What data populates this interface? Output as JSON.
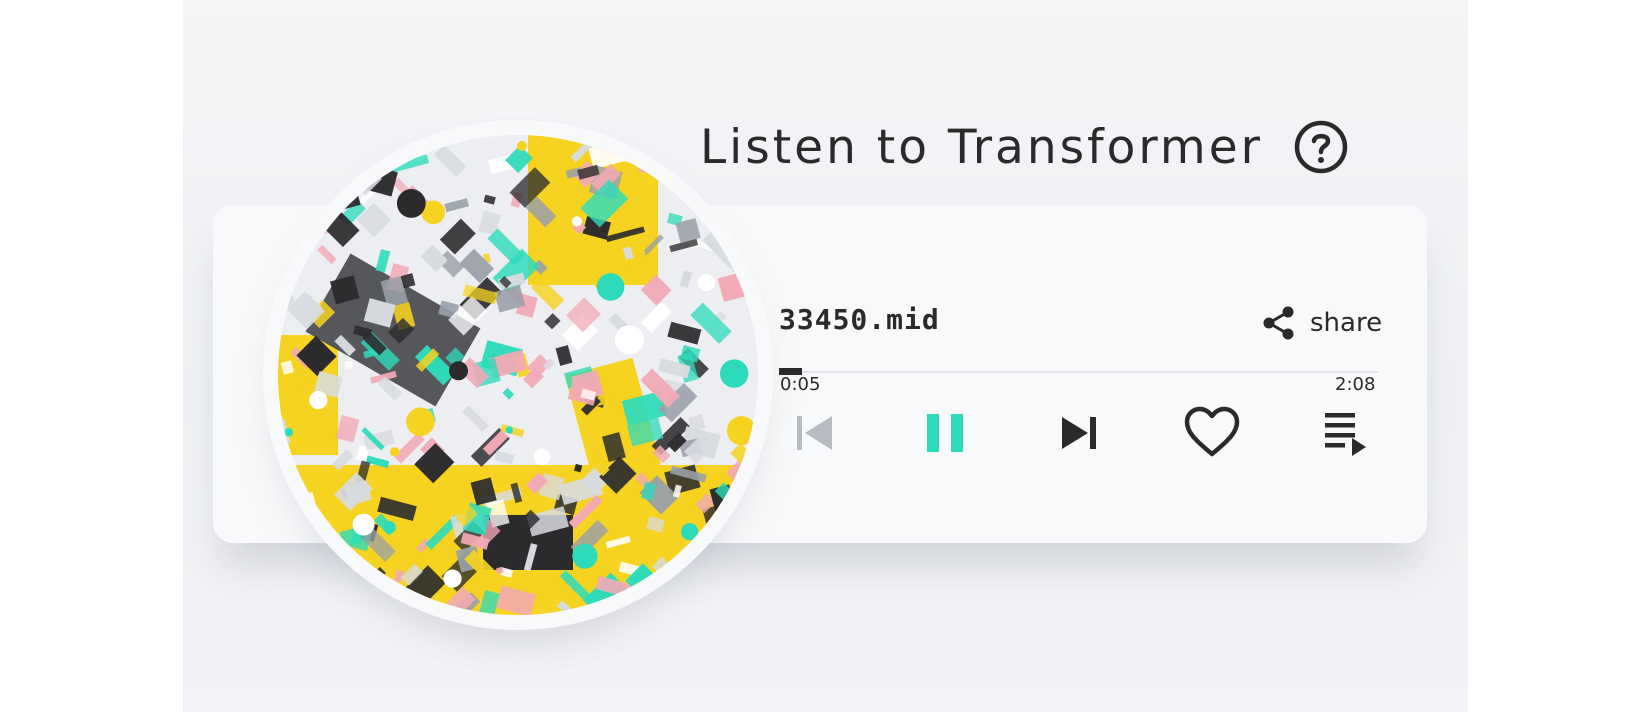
{
  "header": {
    "title": "Listen to Transformer",
    "help_icon": "help-circle-icon"
  },
  "player": {
    "track_name": "33450.mid",
    "share_label": "share",
    "current_time": "0:05",
    "duration": "2:08",
    "progress": 0.039,
    "controls": [
      {
        "name": "previous-button",
        "icon": "skip-previous-icon",
        "enabled": false
      },
      {
        "name": "pause-button",
        "icon": "pause-icon",
        "active": true
      },
      {
        "name": "next-button",
        "icon": "skip-next-icon",
        "enabled": true
      },
      {
        "name": "like-button",
        "icon": "heart-outline-icon"
      },
      {
        "name": "playlist-button",
        "icon": "playlist-play-icon"
      }
    ]
  },
  "colors": {
    "accent": "#2ddbbb",
    "text": "#2a2a2a",
    "disabled": "#b6bcc2",
    "art_yellow": "#f5d320",
    "art_pink": "#f2a9b6",
    "art_dark": "#2b2b2d",
    "art_gray": "#d8dbe0",
    "art_teal": "#2ddbbb"
  },
  "album_art": {
    "icon": "generative-album-art"
  }
}
